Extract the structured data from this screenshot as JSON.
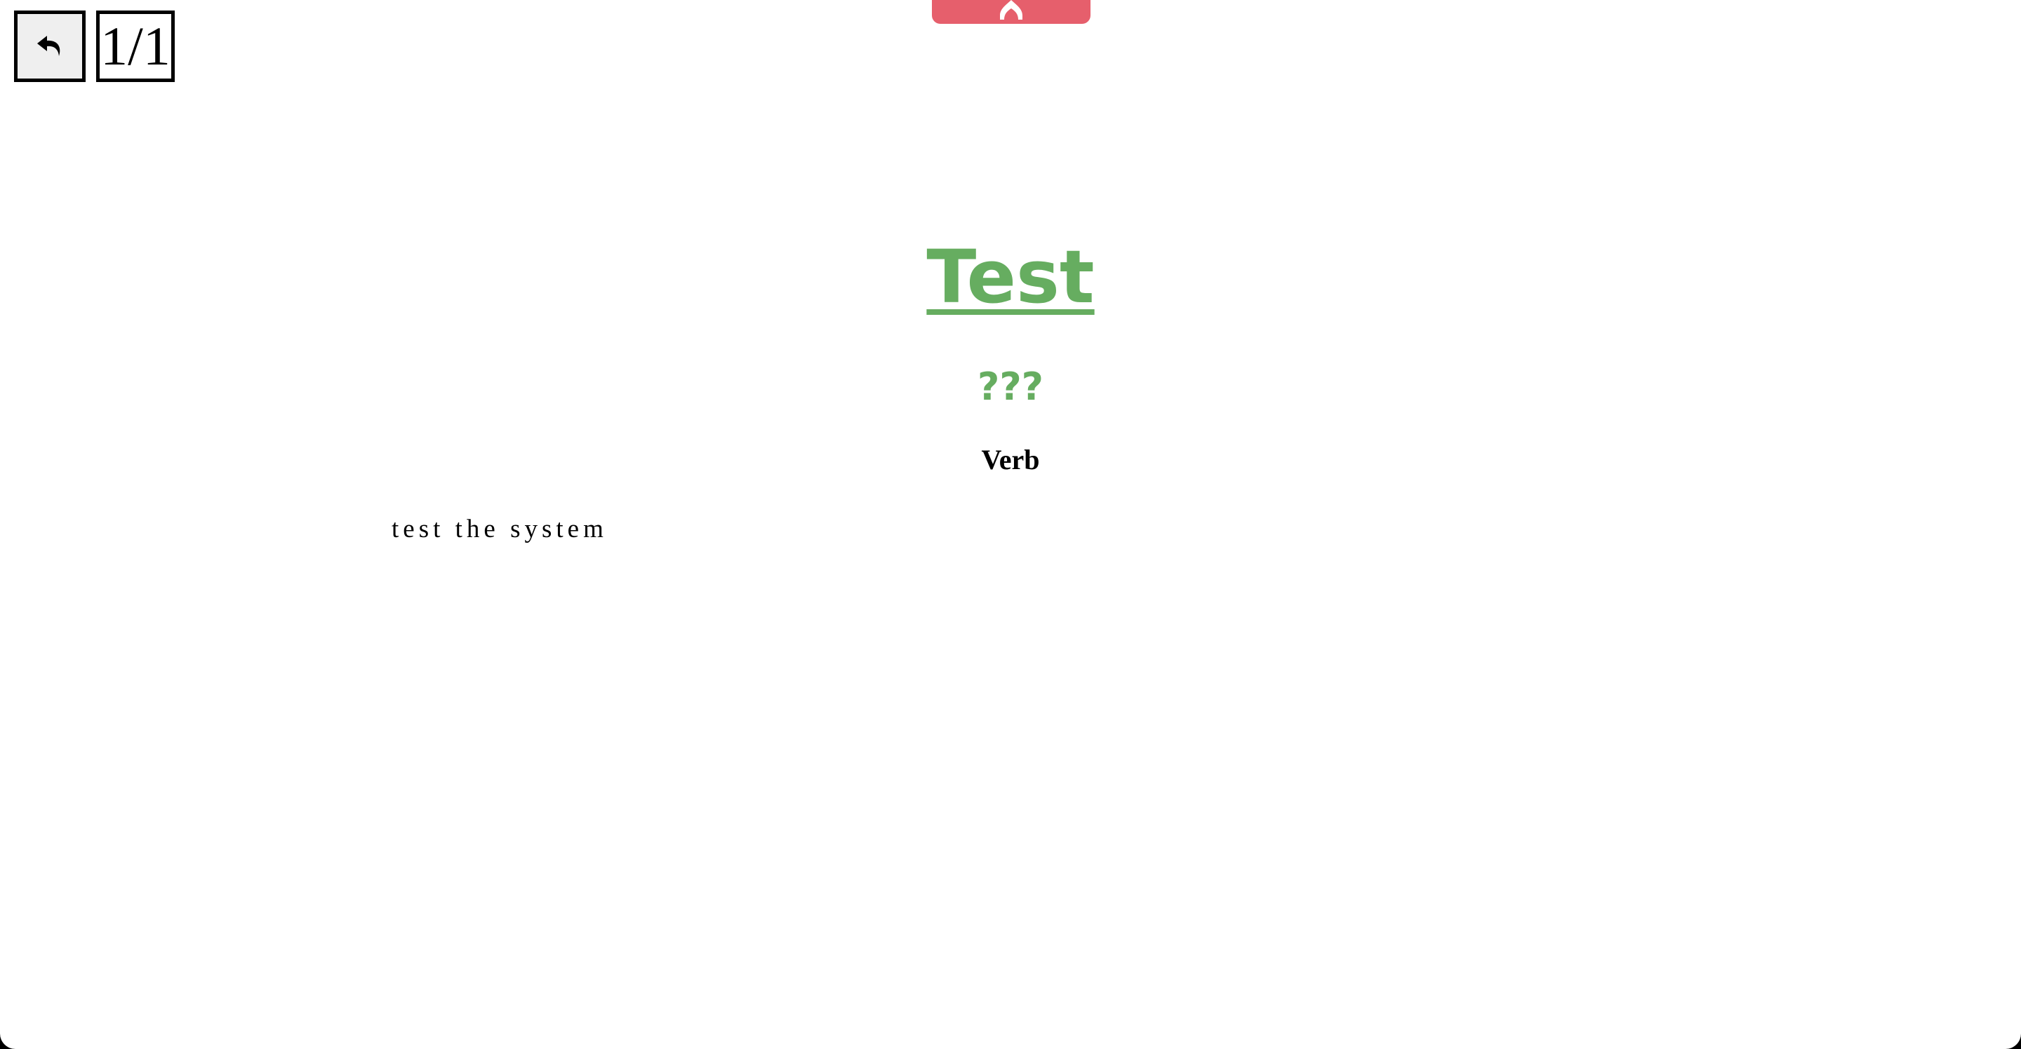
{
  "toolbar": {
    "back_icon": "undo-arrow-icon",
    "counter": "1/1"
  },
  "top_tab": {
    "icon": "flame-icon",
    "color": "#e65f6c"
  },
  "card": {
    "word": "Test",
    "reading": "???",
    "part_of_speech": "Verb",
    "definition": "test the system",
    "accent_color": "#66ad60"
  }
}
